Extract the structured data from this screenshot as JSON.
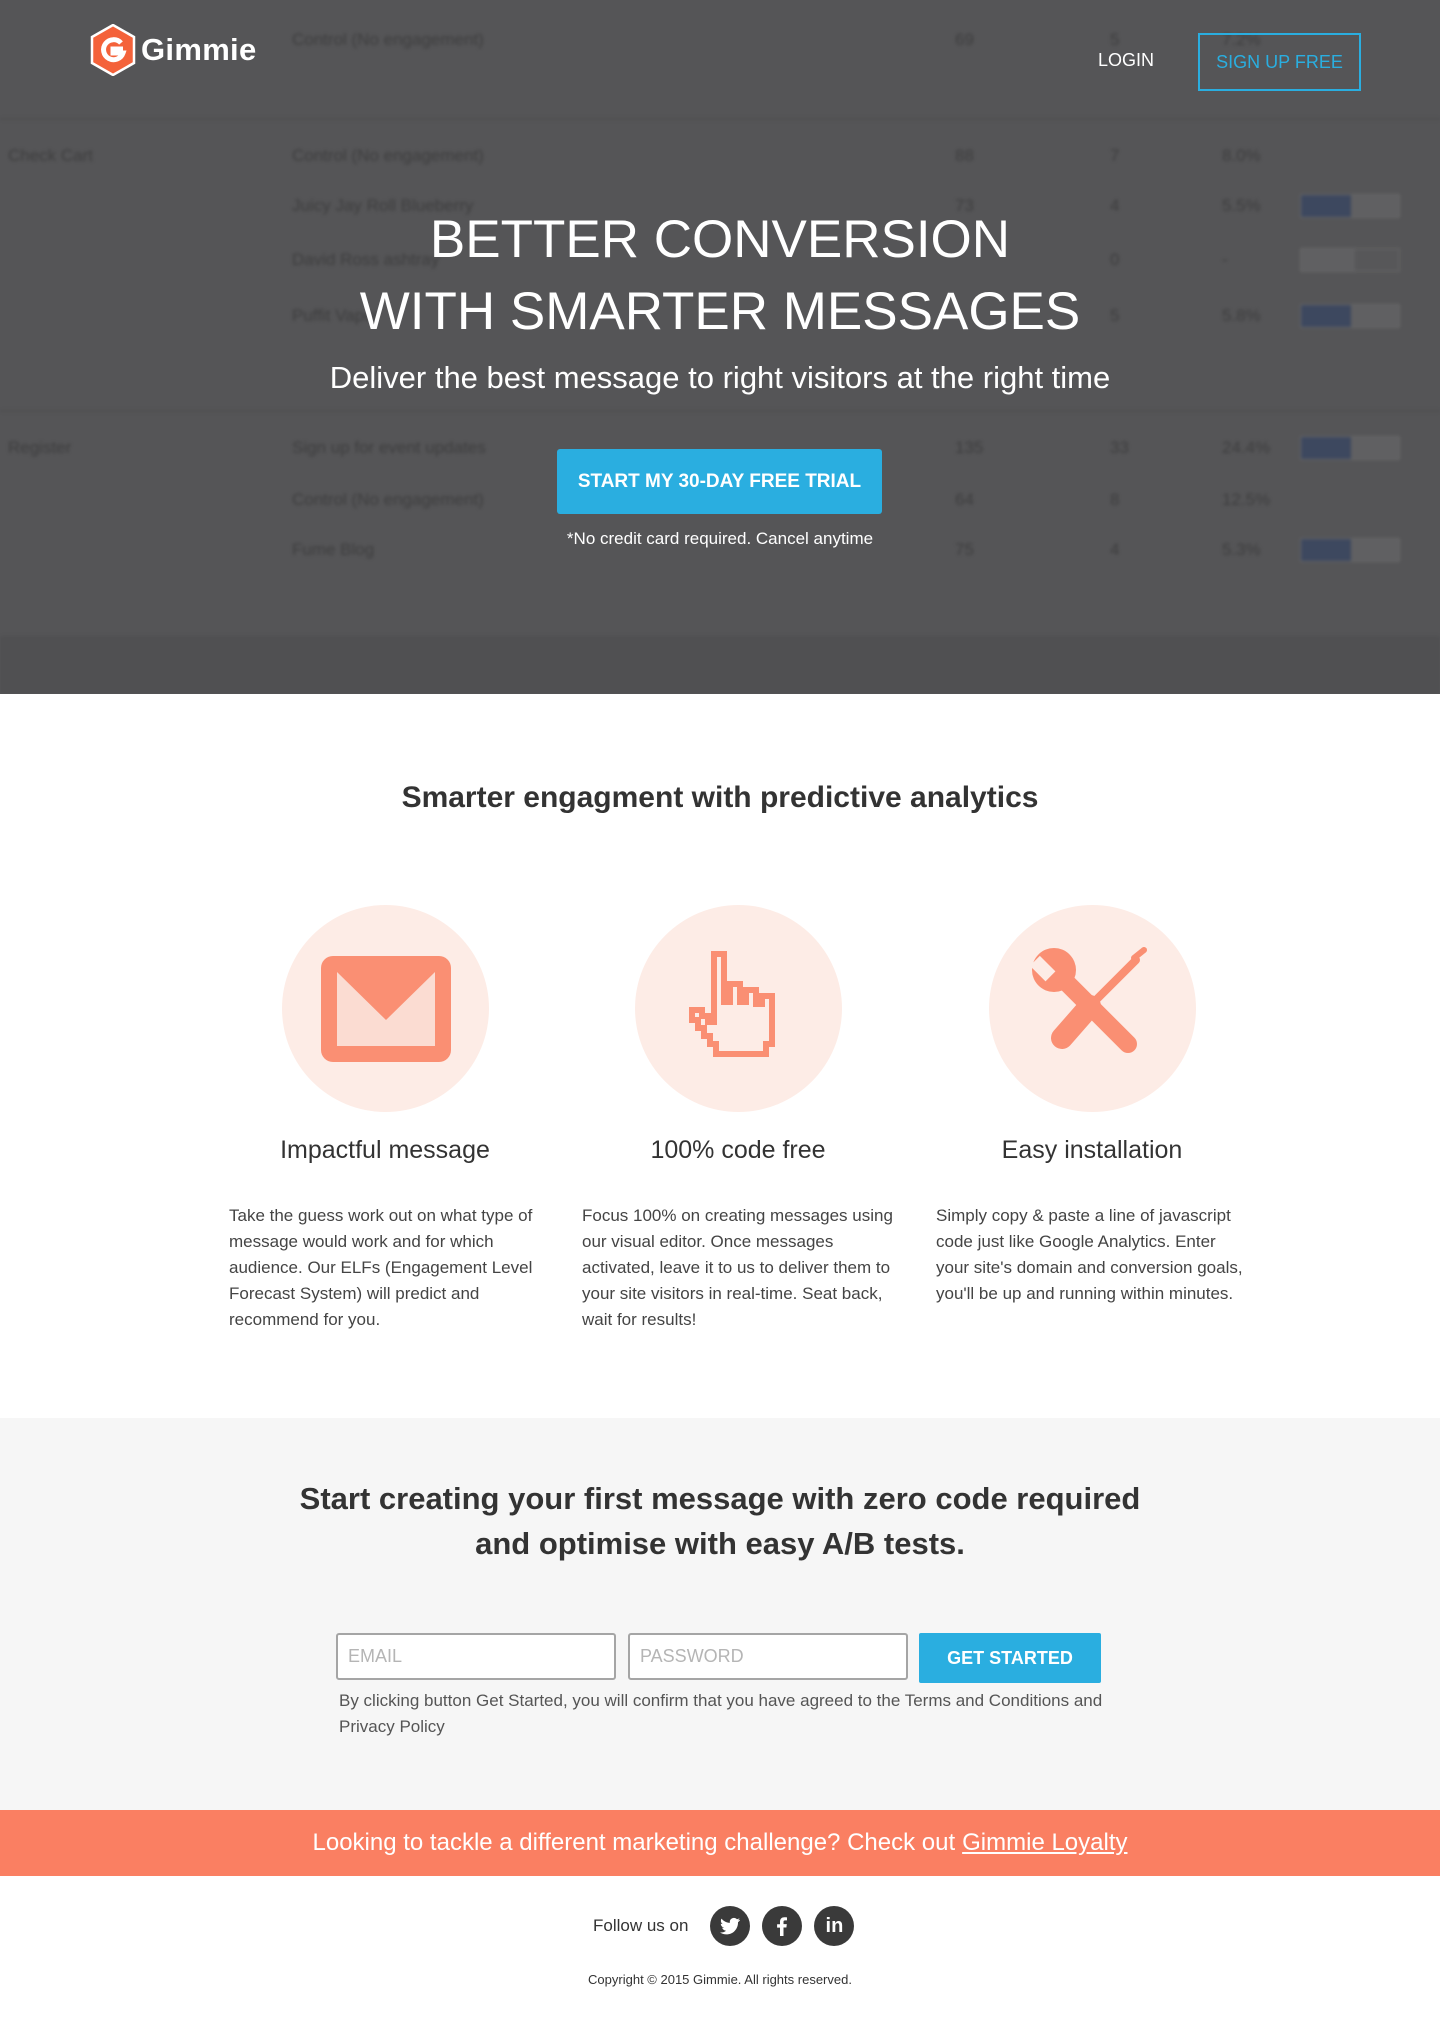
{
  "header": {
    "brand": "Gimmie",
    "login_label": "LOGIN",
    "signup_label": "SIGN UP FREE"
  },
  "hero": {
    "title_line1": "BETTER CONVERSION",
    "title_line2": "WITH SMARTER MESSAGES",
    "subtitle": "Deliver the best message to right visitors at the right time",
    "cta_label": "START MY 30-DAY FREE TRIAL",
    "cta_note": "*No credit card required. Cancel anytime"
  },
  "background_table": {
    "rows": [
      {
        "goal": "",
        "message": "Control (No engagement)",
        "visitors": "69",
        "conversions": "5",
        "rate": "7.2%",
        "toggle": ""
      },
      {
        "goal": "Check Cart",
        "message": "Control (No engagement)",
        "visitors": "88",
        "conversions": "7",
        "rate": "8.0%",
        "toggle": ""
      },
      {
        "goal": "",
        "message": "Juicy Jay Roll Blueberry",
        "visitors": "73",
        "conversions": "4",
        "rate": "5.5%",
        "toggle": "YES"
      },
      {
        "goal": "",
        "message": "David Ross ashtray",
        "visitors": "",
        "conversions": "0",
        "rate": "-",
        "toggle": "NO"
      },
      {
        "goal": "",
        "message": "Puffit Vapor",
        "visitors": "",
        "conversions": "5",
        "rate": "5.8%",
        "toggle": "YES"
      },
      {
        "goal": "Register",
        "message": "Sign up for event updates",
        "visitors": "135",
        "conversions": "33",
        "rate": "24.4%",
        "toggle": "YES"
      },
      {
        "goal": "",
        "message": "Control (No engagement)",
        "visitors": "64",
        "conversions": "8",
        "rate": "12.5%",
        "toggle": ""
      },
      {
        "goal": "",
        "message": "Fume Blog",
        "visitors": "75",
        "conversions": "4",
        "rate": "5.3%",
        "toggle": "YES"
      }
    ]
  },
  "features": {
    "title": "Smarter engagment with predictive analytics",
    "items": [
      {
        "icon": "envelope-icon",
        "title": "Impactful message",
        "text": "Take the guess work out on what type of message would work and for which audience. Our ELFs (Engagement Level Forecast System) will predict and recommend for you."
      },
      {
        "icon": "pointer-hand-icon",
        "title": "100% code free",
        "text": "Focus 100% on creating messages using our visual editor. Once messages activated, leave it to us to deliver them to your site visitors in real-time. Seat back, wait for results!"
      },
      {
        "icon": "tools-icon",
        "title": "Easy installation",
        "text": "Simply copy & paste a line of javascript code just like Google Analytics. Enter your site's domain and conversion goals, you'll be up and running within minutes."
      }
    ]
  },
  "signup": {
    "title_line1": "Start creating your first message with zero code required",
    "title_line2": "and optimise with easy A/B tests.",
    "email_placeholder": "EMAIL",
    "password_placeholder": "PASSWORD",
    "button_label": "GET STARTED",
    "terms": "By clicking button Get Started, you will confirm that you have agreed to the Terms and Conditions and Privacy Policy"
  },
  "banner": {
    "text": "Looking to tackle a different marketing challenge? Check out",
    "link_label": "Gimmie Loyalty"
  },
  "footer": {
    "follow_label": "Follow us on",
    "social": [
      "twitter-icon",
      "facebook-icon",
      "linkedin-icon"
    ],
    "linkedin_glyph": "in",
    "copyright": "Copyright © 2015 Gimmie. All rights reserved."
  },
  "colors": {
    "accent_blue": "#2aaee0",
    "brand_orange": "#fa7f62",
    "icon_circle": "#fdece6",
    "hero_overlay": "#555557"
  }
}
